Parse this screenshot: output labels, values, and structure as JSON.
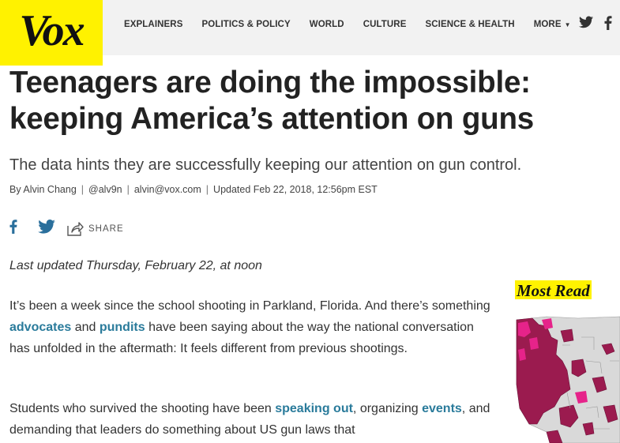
{
  "header": {
    "logo": "Vox",
    "nav": [
      "EXPLAINERS",
      "POLITICS & POLICY",
      "WORLD",
      "CULTURE",
      "SCIENCE & HEALTH"
    ],
    "more": "MORE",
    "icons": [
      "twitter-icon",
      "facebook-icon"
    ]
  },
  "article": {
    "headline": "Teenagers are doing the impossible: keeping America’s attention on guns",
    "subhead": "The data hints they are successfully keeping our attention on gun control.",
    "byline": {
      "author": "By Alvin Chang",
      "twitter": "@alv9n",
      "email": "alvin@vox.com",
      "updated": "Updated Feb 22, 2018, 12:56pm EST"
    },
    "share_label": "SHARE",
    "last_updated": "Last updated Thursday, February 22, at noon",
    "para1": {
      "t1": "It’s been a week since the school shooting in Parkland, Florida. And there’s something ",
      "link1": "advocates",
      "t2": " and ",
      "link2": "pundits",
      "t3": " have been saying about the way the national conversation has unfolded in the aftermath: It feels different from previous shootings."
    },
    "para2": {
      "t1": "Students who survived the shooting have been ",
      "link1": "speaking out",
      "t2": ", organizing ",
      "link2": "events",
      "t3": ", and demanding that leaders do something about US gun laws that"
    }
  },
  "sidebar": {
    "most_read": "Most Read",
    "colors": {
      "dark": "#9b1b4f",
      "pink": "#e6238a",
      "gray": "#d9d9d9"
    }
  },
  "colors": {
    "brand_yellow": "#fff200",
    "link": "#2a7b9b",
    "social": "#2a6f9c"
  }
}
